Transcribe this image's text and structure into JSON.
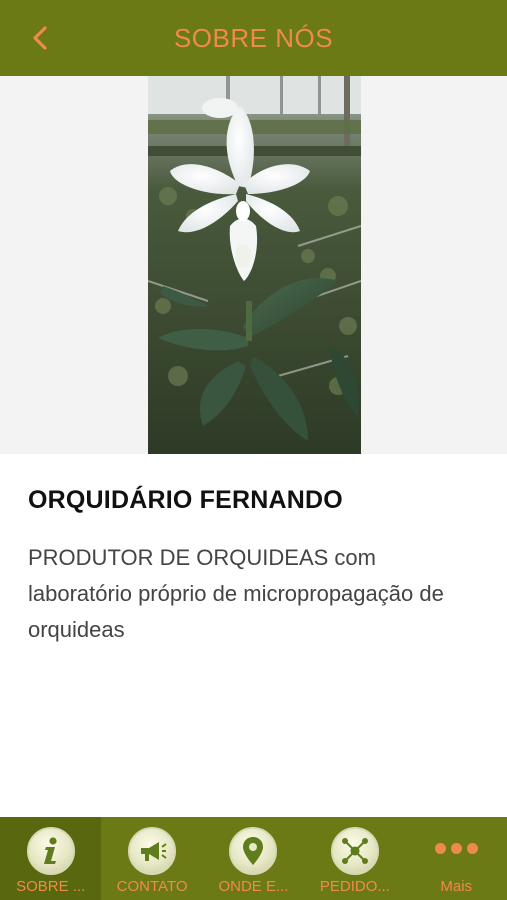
{
  "header": {
    "title": "SOBRE NÓS",
    "back_icon": "chevron-left-icon",
    "accent_color": "#f08a4b",
    "bar_color": "#6b7a14"
  },
  "hero": {
    "image_subject": "white orchid flower in greenhouse"
  },
  "content": {
    "title": "ORQUIDÁRIO FERNANDO",
    "description": "PRODUTOR DE ORQUIDEAS com laboratório próprio de micropropagação de orquideas"
  },
  "tabbar": {
    "tabs": [
      {
        "label": "SOBRE ...",
        "icon": "info-icon",
        "active": true
      },
      {
        "label": "CONTATO",
        "icon": "megaphone-icon",
        "active": false
      },
      {
        "label": "ONDE E...",
        "icon": "map-pin-icon",
        "active": false
      },
      {
        "label": "PEDIDO...",
        "icon": "network-icon",
        "active": false
      },
      {
        "label": "Mais",
        "icon": "more-dots-icon",
        "active": false
      }
    ]
  }
}
